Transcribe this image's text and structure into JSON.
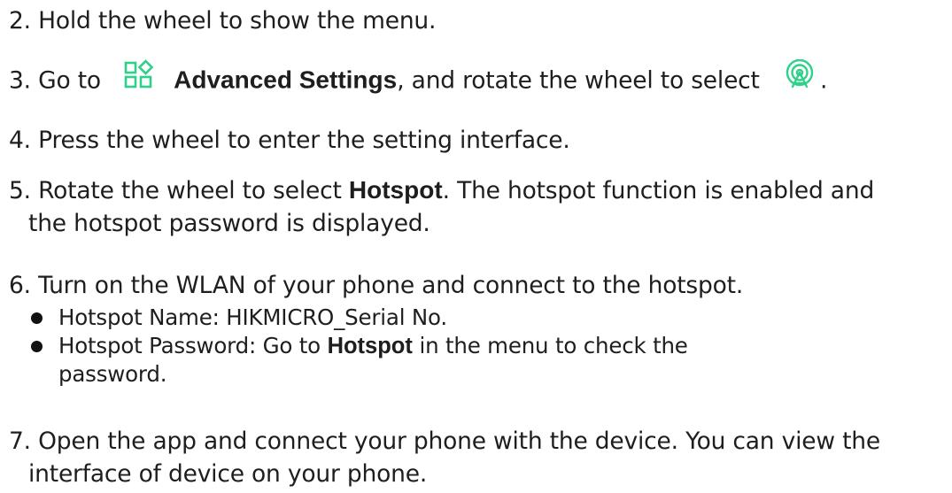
{
  "steps": [
    {
      "num": "2.",
      "text": "Hold the wheel to show the menu."
    },
    {
      "num": "3.",
      "pre": "Go to",
      "icon1": "advanced-settings-icon",
      "bold": "Advanced Settings",
      "post": ", and rotate the wheel to select",
      "icon2": "hotspot-signal-icon",
      "end": "."
    },
    {
      "num": "4.",
      "text": "Press the wheel to enter the setting interface."
    },
    {
      "num": "5.",
      "pre": "Rotate the wheel to select",
      "bold": "Hotspot",
      "post": ". The hotspot function is enabled and",
      "cont": "the hotspot password is displayed."
    },
    {
      "num": "6.",
      "text": "Turn on the WLAN of your phone and connect to the hotspot.",
      "bullets": [
        {
          "text": "Hotspot Name: HIKMICRO_Serial No."
        },
        {
          "pre": "Hotspot Password: Go to",
          "bold": "Hotspot",
          "post": "in the menu to check the",
          "cont": "password."
        }
      ]
    },
    {
      "num": "7.",
      "text": "Open the app and connect your phone with the device. You can view the",
      "cont": "interface of device on your phone."
    }
  ],
  "colors": {
    "text": "#1e1e1e",
    "icon_accent": "#2fd18a"
  }
}
